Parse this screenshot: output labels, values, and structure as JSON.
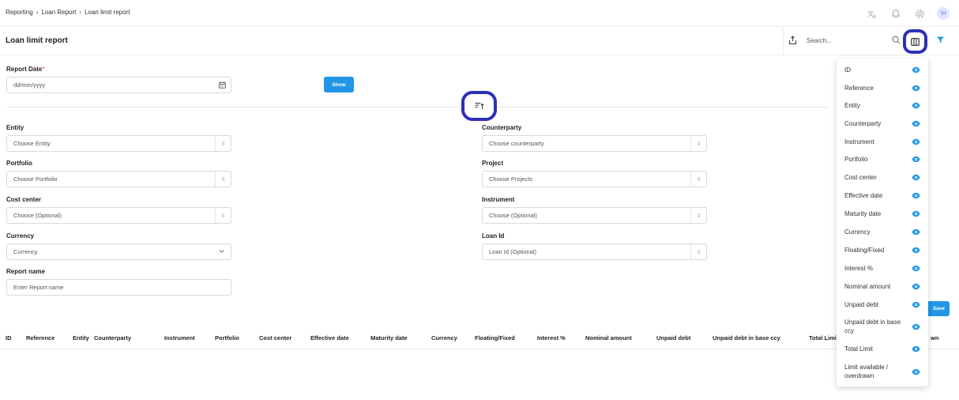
{
  "breadcrumb": [
    "Reporting",
    "Loan Report",
    "Loan limit report"
  ],
  "user": {
    "initials": "VI"
  },
  "page": {
    "title": "Loan limit report"
  },
  "search": {
    "placeholder": "Search..."
  },
  "report_date": {
    "label": "Report Date",
    "placeholder": "dd/mm/yyyy"
  },
  "show_button": "Show",
  "save_button": "Save",
  "filters": {
    "entity": {
      "label": "Entity",
      "placeholder": "Choose Entity"
    },
    "portfolio": {
      "label": "Portfolio",
      "placeholder": "Choose Portfolio"
    },
    "cost_center": {
      "label": "Cost center",
      "placeholder": "Choose (Optional)"
    },
    "currency": {
      "label": "Currency",
      "placeholder": "Currency"
    },
    "report_name": {
      "label": "Report name",
      "placeholder": "Enter Report name"
    },
    "counterparty": {
      "label": "Counterparty",
      "placeholder": "Choose counterparty"
    },
    "project": {
      "label": "Project",
      "placeholder": "Choose Projects"
    },
    "instrument": {
      "label": "Instrument",
      "placeholder": "Choose (Optional)"
    },
    "loan_id": {
      "label": "Loan Id",
      "placeholder": "Loan Id (Optional)"
    }
  },
  "table": {
    "columns": [
      "ID",
      "Reference",
      "Entity",
      "Counterparty",
      "Instrument",
      "Portfolio",
      "Cost center",
      "Effective date",
      "Maturity date",
      "Currency",
      "Floating/Fixed",
      "Interest %",
      "Nominal amount",
      "Unpaid debt",
      "Unpaid debt in base ccy",
      "Total Limit",
      "wn"
    ]
  },
  "column_menu": {
    "items": [
      "ID",
      "Reference",
      "Entity",
      "Counterparty",
      "Instrument",
      "Portfolio",
      "Cost center",
      "Effective date",
      "Maturity date",
      "Currency",
      "Floating/Fixed",
      "Interest %",
      "Nominal amount",
      "Unpaid debt",
      "Unpaid debt in base ccy",
      "Total Limit",
      "Limit available / overdrawn"
    ]
  },
  "colors": {
    "accent": "#2196e6",
    "highlight": "#2d2fb8"
  }
}
